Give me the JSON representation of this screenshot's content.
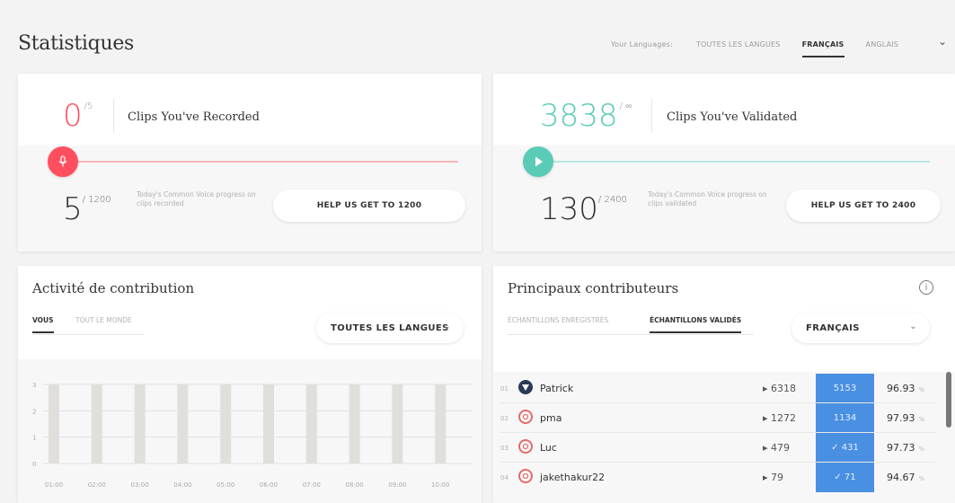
{
  "header": {
    "title": "Statistiques",
    "languages_label": "Your Languages:",
    "tabs": [
      {
        "label": "TOUTES LES LANGUES",
        "active": false
      },
      {
        "label": "FRANÇAIS",
        "active": true
      },
      {
        "label": "ANGLAIS",
        "active": false
      }
    ]
  },
  "recorded": {
    "count": "0",
    "goal": "/5",
    "label": "Clips You've Recorded",
    "progress": 0,
    "progress_value": "5",
    "progress_goal": "/ 1200",
    "progress_desc": "Today's Common Voice progress on clips recorded",
    "button": "HELP US GET TO 1200",
    "accent": "#ff4f5e"
  },
  "validated": {
    "count": "3838",
    "goal": "/ ∞",
    "label": "Clips You've Validated",
    "progress": 0,
    "progress_value": "130",
    "progress_goal": "/ 2400",
    "progress_desc": "Today's Common Voice progress on clips validated",
    "button": "HELP US GET TO 2400",
    "accent": "#59cbb7"
  },
  "activity": {
    "title": "Activité de contribution",
    "tabs": [
      {
        "label": "VOUS",
        "active": true
      },
      {
        "label": "TOUT LE MONDE",
        "active": false
      }
    ],
    "select": "TOUTES LES LANGUES",
    "chart_data": {
      "type": "bar",
      "categories": [
        "01:00",
        "02:00",
        "03:00",
        "04:00",
        "05:00",
        "06:00",
        "07:00",
        "08:00",
        "09:00",
        "10:00"
      ],
      "values": [
        3,
        3,
        3,
        3,
        3,
        3,
        3,
        3,
        3,
        3
      ],
      "ylim": [
        0,
        3
      ],
      "yticks": [
        "0",
        "1",
        "2",
        "3"
      ],
      "grid": true
    }
  },
  "leaderboard": {
    "title": "Principaux contributeurs",
    "tabs": [
      {
        "label": "ÉCHANTILLONS ENREGISTRÉS",
        "active": false
      },
      {
        "label": "ÉCHANTILLONS VALIDÉS",
        "active": true
      }
    ],
    "select": "FRANÇAIS",
    "rows": [
      {
        "rank": "01",
        "name": "Patrick",
        "recorded": "▸ 6318",
        "validated": "5153",
        "pct": "96.93",
        "pct_unit": "%"
      },
      {
        "rank": "02",
        "name": "pma",
        "recorded": "▸ 1272",
        "validated": "1134",
        "pct": "97.93",
        "pct_unit": "%"
      },
      {
        "rank": "03",
        "name": "Luc",
        "recorded": "▸ 479",
        "validated": "✓ 431",
        "pct": "97.73",
        "pct_unit": "%"
      },
      {
        "rank": "04",
        "name": "jakethakur22",
        "recorded": "▸ 79",
        "validated": "✓ 71",
        "pct": "94.67",
        "pct_unit": "%"
      }
    ]
  }
}
